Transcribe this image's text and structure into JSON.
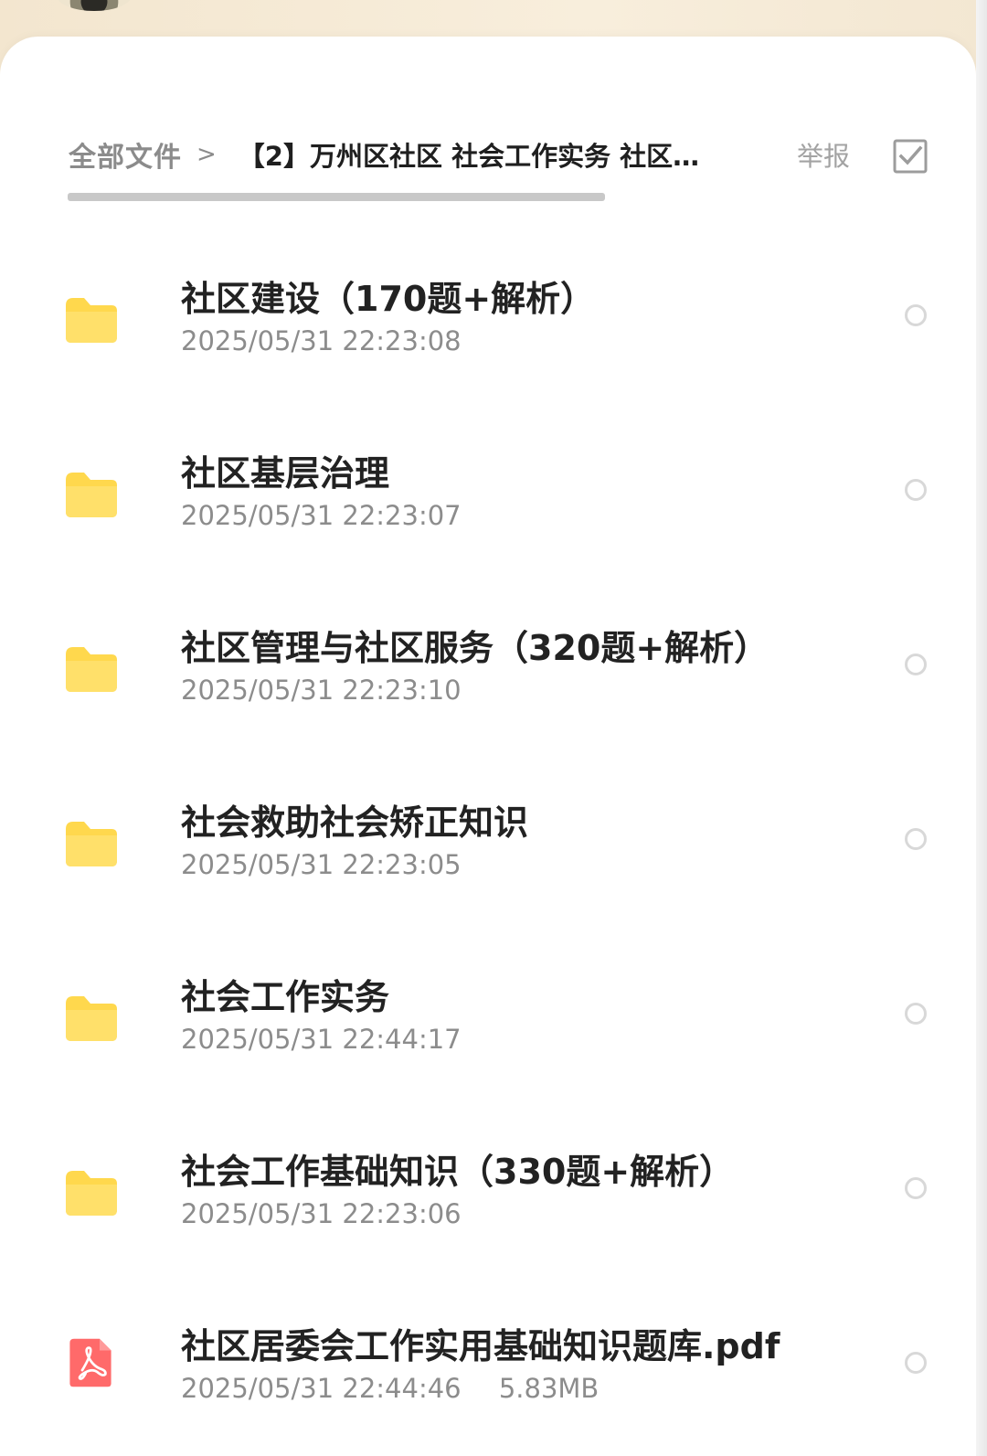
{
  "breadcrumb": {
    "root": "全部文件",
    "separator": ">",
    "current": "【2】万州区社区 社会工作实务 社区…"
  },
  "toolbar": {
    "report": "举报"
  },
  "icons": {
    "folder": "folder-icon",
    "pdf": "pdf-icon",
    "select": "checkbox-icon",
    "radio": "radio-unchecked-icon"
  },
  "colors": {
    "folder": "#ffd84d",
    "pdf": "#ff6a6a",
    "text_primary": "#222222",
    "text_secondary": "#8c8c8c"
  },
  "files": [
    {
      "name": "社区建设（170题+解析）",
      "date": "2025/05/31 22:23:08",
      "size": "",
      "type": "folder"
    },
    {
      "name": "社区基层治理",
      "date": "2025/05/31 22:23:07",
      "size": "",
      "type": "folder"
    },
    {
      "name": "社区管理与社区服务（320题+解析）",
      "date": "2025/05/31 22:23:10",
      "size": "",
      "type": "folder"
    },
    {
      "name": "社会救助社会矫正知识",
      "date": "2025/05/31 22:23:05",
      "size": "",
      "type": "folder"
    },
    {
      "name": "社会工作实务",
      "date": "2025/05/31 22:44:17",
      "size": "",
      "type": "folder"
    },
    {
      "name": "社会工作基础知识（330题+解析）",
      "date": "2025/05/31 22:23:06",
      "size": "",
      "type": "folder"
    },
    {
      "name": "社区居委会工作实用基础知识题库.pdf",
      "date": "2025/05/31 22:44:46",
      "size": "5.83MB",
      "type": "pdf"
    }
  ]
}
